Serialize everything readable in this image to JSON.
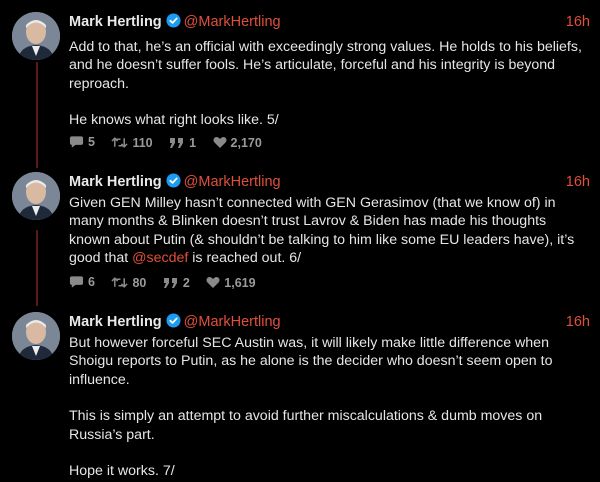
{
  "colors": {
    "accent": "#e0503a",
    "background": "#000000",
    "text": "#e6e6e6",
    "muted": "#9a9a9a",
    "thread_line": "#5a1a1a"
  },
  "tweets": [
    {
      "name": "Mark Hertling",
      "handle": "@MarkHertling",
      "time": "16h",
      "paragraphs": [
        "Add to that, he’s an official with exceedingly strong values. He holds to his beliefs, and he doesn’t suffer fools. He’s articulate, forceful and his integrity is beyond reproach.",
        "He knows what right looks like. 5/"
      ],
      "stats": {
        "replies": "5",
        "retweets": "110",
        "quotes": "1",
        "likes": "2,170"
      }
    },
    {
      "name": "Mark Hertling",
      "handle": "@MarkHertling",
      "time": "16h",
      "paragraphs": [
        "Given GEN Milley hasn’t connected with GEN Gerasimov (that we know of) in many months & Blinken doesn’t trust Lavrov & Biden has made his thoughts known about Putin (& shouldn’t be talking to him like some EU leaders have), it’s good that ",
        "@secdef",
        " is reached out. 6/"
      ],
      "stats": {
        "replies": "6",
        "retweets": "80",
        "quotes": "2",
        "likes": "1,619"
      }
    },
    {
      "name": "Mark Hertling",
      "handle": "@MarkHertling",
      "time": "16h",
      "paragraphs": [
        "But however forceful SEC Austin was, it will likely make little difference when Shoigu reports to Putin, as he alone is the decider who doesn’t seem open to influence.",
        "This is simply an attempt to avoid further miscalculations & dumb moves on Russia’s part.",
        "Hope it works. 7/"
      ]
    }
  ]
}
